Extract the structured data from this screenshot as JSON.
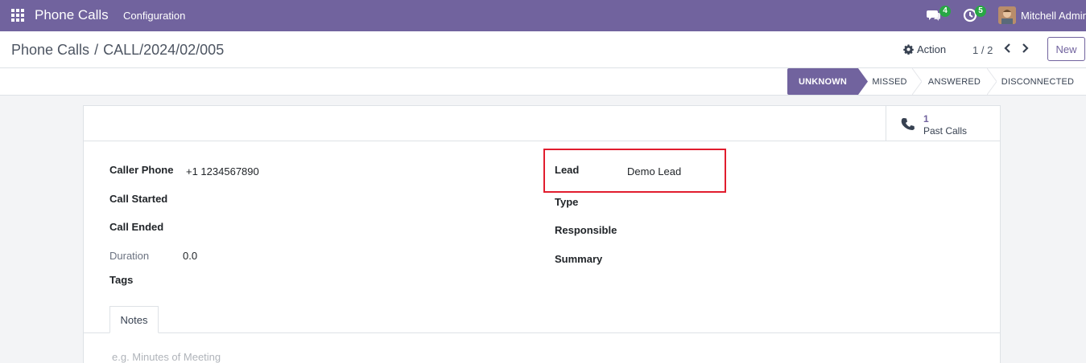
{
  "navbar": {
    "app_title": "Phone Calls",
    "menu": [
      "Configuration"
    ],
    "messages_badge": "4",
    "activities_badge": "5",
    "user_name": "Mitchell Admin",
    "color": "#71639e"
  },
  "control_panel": {
    "breadcrumb_root": "Phone Calls",
    "breadcrumb_separator": "/",
    "breadcrumb_current": "CALL/2024/02/005",
    "action_label": "Action",
    "pager": "1 / 2",
    "new_label": "New"
  },
  "statusbar": {
    "stages": [
      "UNKNOWN",
      "MISSED",
      "ANSWERED",
      "DISCONNECTED"
    ],
    "active_stage": "UNKNOWN"
  },
  "smart_button": {
    "count": "1",
    "label": "Past Calls",
    "icon": "phone-icon"
  },
  "form": {
    "left": [
      {
        "label": "Caller Phone",
        "value": "+1 1234567890"
      },
      {
        "label": "Call Started",
        "value": ""
      },
      {
        "label": "Call Ended",
        "value": ""
      },
      {
        "label": "Duration",
        "value": "0.0"
      },
      {
        "label": "Tags",
        "value": ""
      }
    ],
    "right": [
      {
        "label": "Lead",
        "value": "Demo Lead"
      },
      {
        "label": "Type",
        "value": ""
      },
      {
        "label": "Responsible",
        "value": ""
      },
      {
        "label": "Summary",
        "value": ""
      }
    ]
  },
  "notebook": {
    "tab_label": "Notes",
    "notes_placeholder": "e.g. Minutes of Meeting"
  },
  "colors": {
    "brand": "#71639e",
    "highlight": "#e11d2e",
    "badge": "#28a745"
  }
}
